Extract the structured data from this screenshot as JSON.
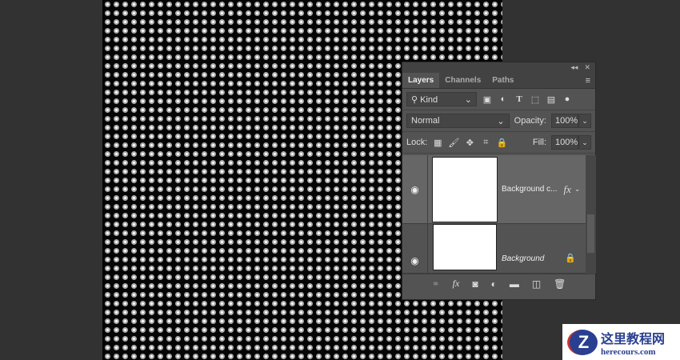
{
  "panel": {
    "tabs": [
      "Layers",
      "Channels",
      "Paths"
    ],
    "filter": "Kind",
    "blend_mode": "Normal",
    "opacity_label": "Opacity:",
    "opacity": "100%",
    "lock_label": "Lock:",
    "fill_label": "Fill:",
    "fill": "100%"
  },
  "layers": [
    {
      "name": "Background c...",
      "fx": "fx",
      "selected": true
    },
    {
      "name": "Background",
      "locked": true
    }
  ],
  "logo": {
    "title": "这里教程网",
    "url": "herecours.com"
  }
}
